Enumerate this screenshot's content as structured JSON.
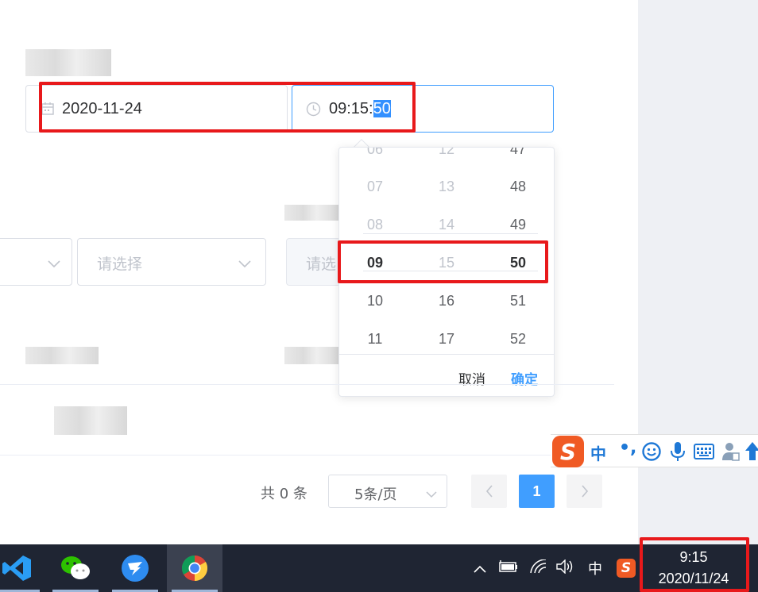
{
  "date_input": {
    "value": "2020-11-24"
  },
  "time_input": {
    "value_prefix": "09:15:",
    "value_selected": "50"
  },
  "select_row": [
    {
      "placeholder": ""
    },
    {
      "placeholder": "请选择"
    },
    {
      "placeholder": "请选"
    }
  ],
  "time_picker": {
    "hours": [
      "06",
      "07",
      "08",
      "09",
      "10",
      "11"
    ],
    "minutes": [
      "12",
      "13",
      "14",
      "15",
      "16",
      "17"
    ],
    "seconds": [
      "47",
      "48",
      "49",
      "50",
      "51",
      "52"
    ],
    "selected": {
      "hour": "09",
      "minute": "15",
      "second": "50"
    },
    "cancel_label": "取消",
    "confirm_label": "确定"
  },
  "pagination": {
    "total_text": "共 0 条",
    "page_size": "5条/页",
    "current_page": "1"
  },
  "ime_toolbar": {
    "mode": "中",
    "punct": "•,",
    "icons": [
      "sogou-logo-icon",
      "emoji-icon",
      "microphone-icon",
      "keyboard-icon",
      "user-icon",
      "skin-icon"
    ]
  },
  "taskbar": {
    "apps": [
      "vscode-icon",
      "wechat-icon",
      "dingtalk-icon",
      "chrome-icon"
    ],
    "tray_lang": "中",
    "time": "9:15",
    "date": "2020/11/24"
  },
  "colors": {
    "accent": "#409eff",
    "annotation": "#e8191b",
    "taskbar": "#1f2533"
  }
}
